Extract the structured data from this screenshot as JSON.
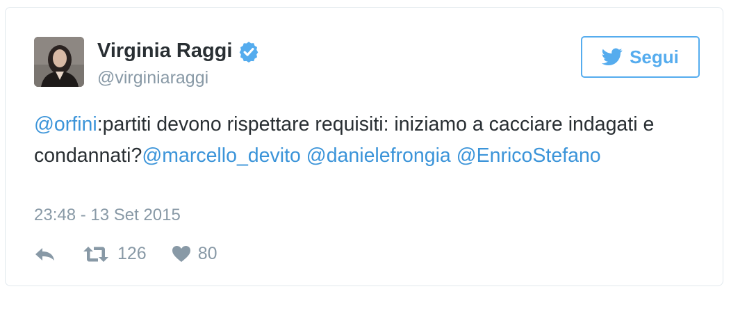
{
  "author": {
    "name": "Virginia Raggi",
    "handle": "@virginiaraggi",
    "verified": true
  },
  "follow_button": {
    "label": "Segui"
  },
  "tweet": {
    "mention_orfini": "@orfini",
    "text_part1": ":partiti devono rispettare requisiti: iniziamo a cacciare indagati e condannati?",
    "mention_marcello": "@marcello_devito",
    "mention_daniele": "@danielefrongia",
    "mention_enrico": "@EnricoStefano",
    "timestamp": "23:48 - 13 Set 2015"
  },
  "actions": {
    "retweet_count": "126",
    "like_count": "80"
  },
  "colors": {
    "link": "#3b94d9",
    "twitter_blue": "#55acee",
    "muted": "#8899a6",
    "text": "#292f33"
  }
}
